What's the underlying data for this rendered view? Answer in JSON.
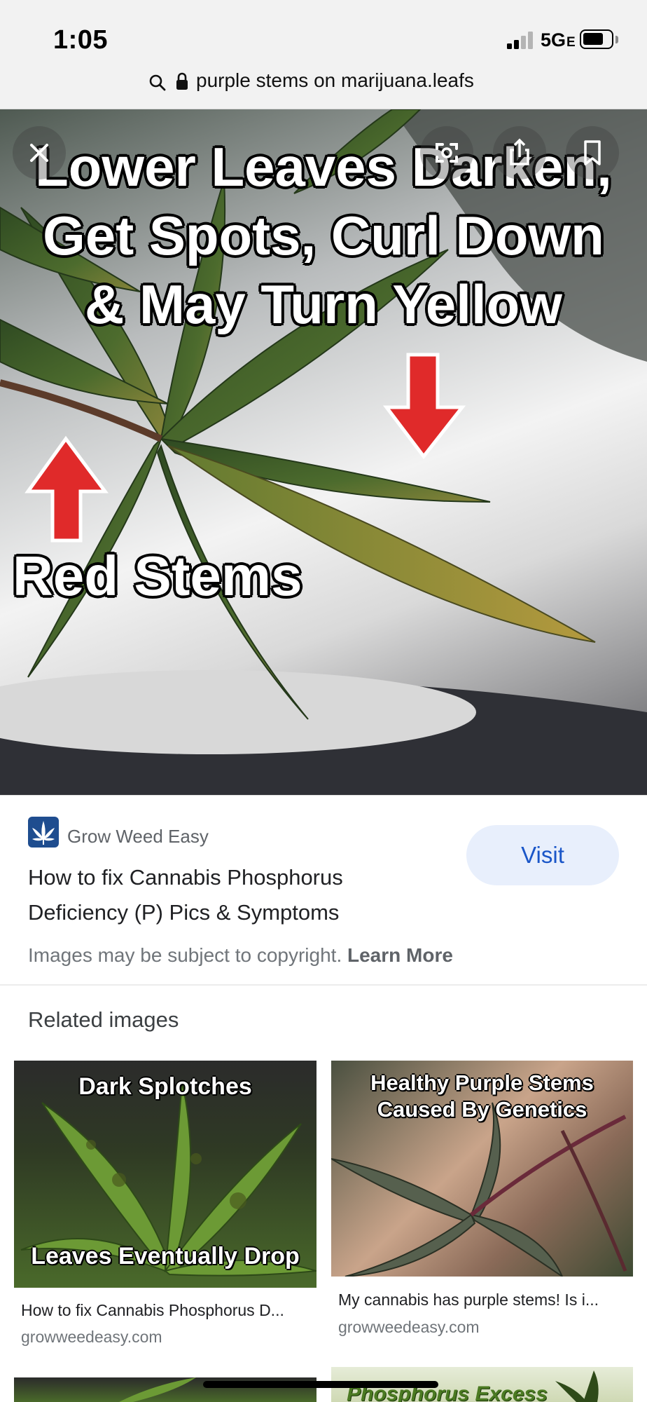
{
  "status_bar": {
    "time": "1:05",
    "network": "5G",
    "network_suffix": "E"
  },
  "url_bar": {
    "text": "purple stems on marijuana.leafs"
  },
  "hero": {
    "headline_lines": [
      "Lower Leaves Darken,",
      "Get Spots, Curl Down",
      "& May Turn Yellow"
    ],
    "caption": "Red Stems",
    "buttons": [
      "close-icon",
      "lens-icon",
      "share-icon",
      "bookmark-icon"
    ]
  },
  "result": {
    "site_name": "Grow Weed Easy",
    "title": "How to fix Cannabis Phosphorus Deficiency (P) Pics & Symptoms",
    "visit_label": "Visit",
    "copyright_text": "Images may be subject to copyright.",
    "learn_more": "Learn More"
  },
  "related": {
    "heading": "Related images",
    "items": [
      {
        "thumb_top": "Dark Splotches",
        "thumb_bottom": "Leaves Eventually Drop",
        "title": "How to fix Cannabis Phosphorus D...",
        "domain": "growweedeasy.com"
      },
      {
        "thumb_top": "Healthy Purple Stems",
        "thumb_bottom": "Caused By Genetics",
        "title": "My cannabis has purple stems! Is i...",
        "domain": "growweedeasy.com"
      },
      {
        "thumb_top": "",
        "thumb_bottom": "",
        "title": "",
        "domain": ""
      },
      {
        "thumb_top": "Phosphorus Excess",
        "thumb_bottom": "",
        "title": "",
        "domain": ""
      }
    ]
  },
  "colors": {
    "visit_bg": "#e8effc",
    "visit_text": "#1a56c8",
    "arrow_red": "#e02a2a",
    "logo_blue": "#1f4d8f"
  }
}
